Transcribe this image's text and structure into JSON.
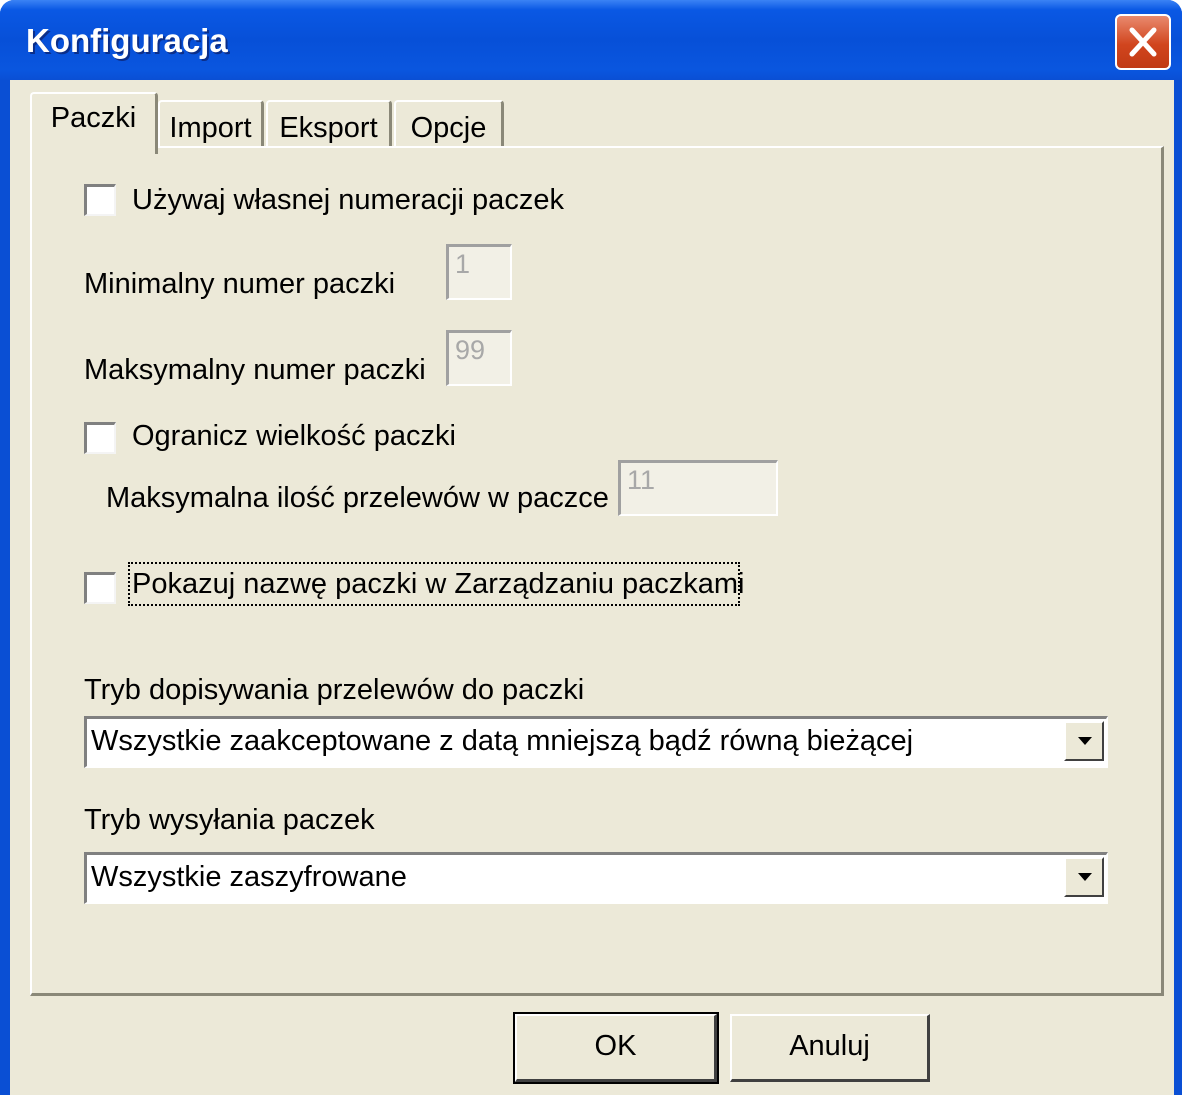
{
  "window": {
    "title": "Konfiguracja",
    "close_icon": "close-icon"
  },
  "tabs": [
    {
      "label": "Paczki",
      "active": true
    },
    {
      "label": "Import",
      "active": false
    },
    {
      "label": "Eksport",
      "active": false
    },
    {
      "label": "Opcje",
      "active": false
    }
  ],
  "paczki": {
    "own_numbering": {
      "label": "Używaj własnej numeracji paczek",
      "checked": false
    },
    "min_number": {
      "label": "Minimalny numer paczki",
      "value": "1"
    },
    "max_number": {
      "label": "Maksymalny numer paczki",
      "value": "99"
    },
    "limit_size": {
      "label": "Ogranicz wielkość paczki",
      "checked": false
    },
    "max_transfers": {
      "label": "Maksymalna ilość przelewów w paczce",
      "value": "11"
    },
    "show_name": {
      "label": "Pokazuj nazwę paczki w Zarządzaniu paczkami",
      "checked": false
    },
    "append_mode": {
      "label": "Tryb dopisywania przelewów do paczki",
      "selected": "Wszystkie zaakceptowane z datą mniejszą bądź równą bieżącej"
    },
    "send_mode": {
      "label": "Tryb wysyłania paczek",
      "selected": "Wszystkie zaszyfrowane"
    }
  },
  "buttons": {
    "ok": "OK",
    "cancel": "Anuluj"
  }
}
